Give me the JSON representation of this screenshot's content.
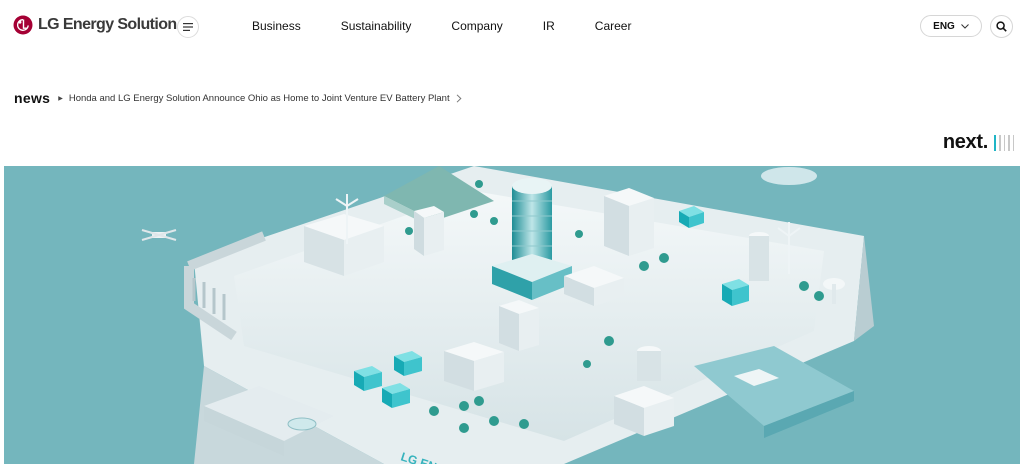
{
  "header": {
    "logo_text": "LG Energy Solution",
    "nav": [
      {
        "label": "Business"
      },
      {
        "label": "Sustainability"
      },
      {
        "label": "Company"
      },
      {
        "label": "IR"
      },
      {
        "label": "Career"
      }
    ],
    "lang_label": "ENG"
  },
  "news": {
    "label": "news",
    "headline": "Honda and LG Energy Solution Announce Ohio as Home to Joint Venture EV Battery Plant"
  },
  "next_label": "next.",
  "hero": {
    "road_text": "LG EN"
  },
  "colors": {
    "brand_red": "#a50034",
    "hero_bg": "#74b6bd",
    "accent_teal": "#1fb5c6"
  }
}
